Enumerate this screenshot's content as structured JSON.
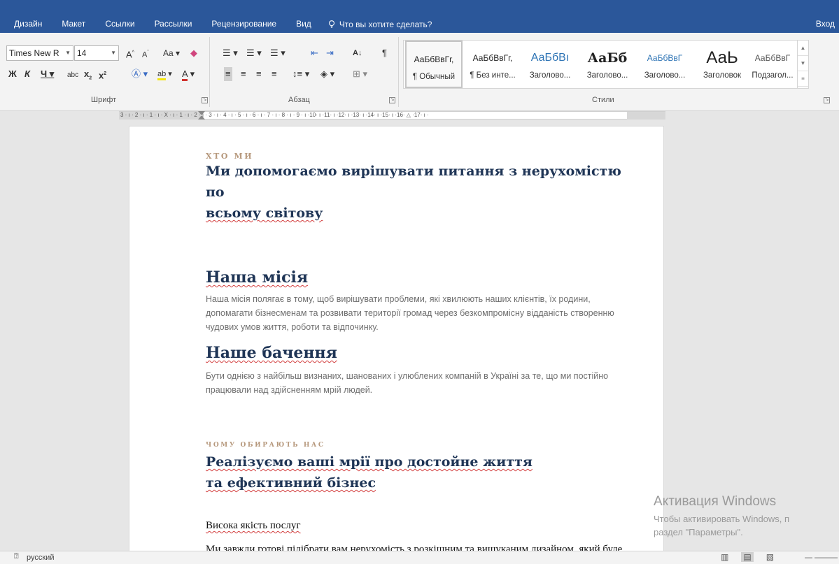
{
  "tabs": [
    "Дизайн",
    "Макет",
    "Ссылки",
    "Рассылки",
    "Рецензирование",
    "Вид"
  ],
  "tell_me": "Что вы хотите сделать?",
  "login": "Вход",
  "ribbon": {
    "font_name": "Times New R",
    "font_size": "14",
    "group_font": "Шрифт",
    "group_paragraph": "Абзац",
    "group_styles": "Стили",
    "styles": [
      {
        "sample": "АаБбВвГг,",
        "name": "¶ Обычный"
      },
      {
        "sample": "АаБбВвГг,",
        "name": "¶ Без инте..."
      },
      {
        "sample": "АаБбВı",
        "name": "Заголово..."
      },
      {
        "sample": "АаБб",
        "name": "Заголово..."
      },
      {
        "sample": "АаБбВвГ",
        "name": "Заголово..."
      },
      {
        "sample": "АаЬ",
        "name": "Заголовок"
      },
      {
        "sample": "АаБбВвГ",
        "name": "Подзагол..."
      }
    ]
  },
  "ruler_text": "3 · ı · 2 · ı · 1 · ı · X · ı · 1 · ı · 2 · ı · 3 · ı · 4 · ı · 5 · ı · 6 · ı · 7 · ı · 8 · ı · 9 · ı ·10· ı ·11· ı ·12· ı ·13· ı ·14· ı ·15· ı ·16· △ ·17· ı ·",
  "doc": {
    "eyebrow1": "ХТО МИ",
    "title1_line1": "Ми допомогаємо вирішувати питання з нерухомістю по",
    "title1_line2": "всьому світову",
    "mission_heading": "Наша місія",
    "mission_text": "Наша місія полягає в тому, щоб вирішувати проблеми, які хвилюють наших клієнтів, їх родини, допомагати бізнесменам та розвивати території громад через безкомпромісну відданість створенню чудових умов життя, роботи та відпочинку.",
    "vision_heading": "Наше бачення",
    "vision_text": "Бути однією з найбільш визнаних, шанованих і улюблених компаній в Україні за те, що ми постійно працювали над здійсненням мрій людей.",
    "eyebrow2": "ЧОМУ ОБИРАЮТЬ НАС",
    "title2_line1": "Реалізуємо ваші мрії про достойне життя",
    "title2_line2": "та ефективний бізнес",
    "quality_heading": "Висока якість послуг",
    "quality_text": "Ми завжди готові підібрати вам нерухомість з розкішним та вишуканим дизайном, який буде гармонічним з навколишньою архітектурою та"
  },
  "watermark": {
    "title": "Активация Windows",
    "line1": "Чтобы активировать Windows, п",
    "line2": "раздел \"Параметры\"."
  },
  "status": {
    "language": "русский"
  },
  "colors": {
    "tab_bar": "#2b579a",
    "heading": "#1f3556",
    "eyebrow": "#b6987c",
    "spell_error": "#d34040"
  }
}
